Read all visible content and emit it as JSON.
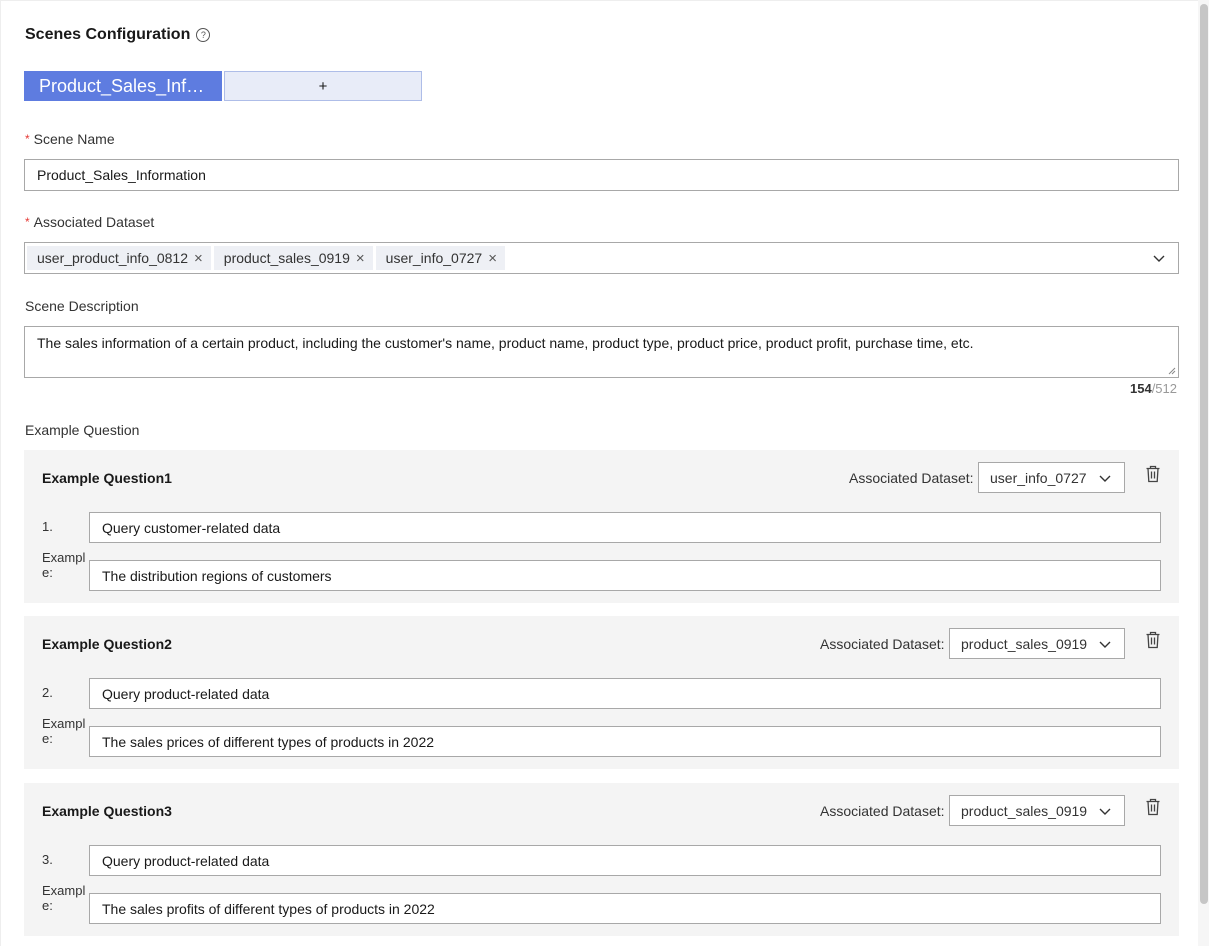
{
  "page": {
    "title": "Scenes Configuration",
    "help_icon": "question-circle-icon"
  },
  "tabs": {
    "active_label": "Product_Sales_Information",
    "add_label": "+"
  },
  "scene_name": {
    "label": "Scene Name",
    "required_mark": "*",
    "value": "Product_Sales_Information"
  },
  "associated_dataset": {
    "label": "Associated Dataset",
    "required_mark": "*",
    "chips": [
      "user_product_info_0812",
      "product_sales_0919",
      "user_info_0727"
    ],
    "chip_remove": "×",
    "chevron_icon": "chevron-down-icon"
  },
  "scene_description": {
    "label": "Scene Description",
    "value": "The sales information of a certain product, including the customer's name, product name, product type, product price, product profit, purchase time, etc.",
    "count": "154",
    "max": "/512"
  },
  "example_section": {
    "label": "Example Question",
    "ds_label": "Associated Dataset:",
    "example_label": "Example:",
    "items": [
      {
        "title": "Example Question1",
        "dataset": "user_info_0727",
        "number": "1.",
        "question": "Query customer-related data",
        "example": "The distribution regions of customers"
      },
      {
        "title": "Example Question2",
        "dataset": "product_sales_0919",
        "number": "2.",
        "question": "Query product-related data",
        "example": "The sales prices of different types of products in 2022"
      },
      {
        "title": "Example Question3",
        "dataset": "product_sales_0919",
        "number": "3.",
        "question": "Query product-related data",
        "example": "The sales profits of different types of products in 2022"
      }
    ]
  },
  "colors": {
    "accent": "#5e7ce0",
    "add_tab_bg": "#e8ecf8",
    "required": "#e53935",
    "block_bg": "#f4f4f4"
  }
}
